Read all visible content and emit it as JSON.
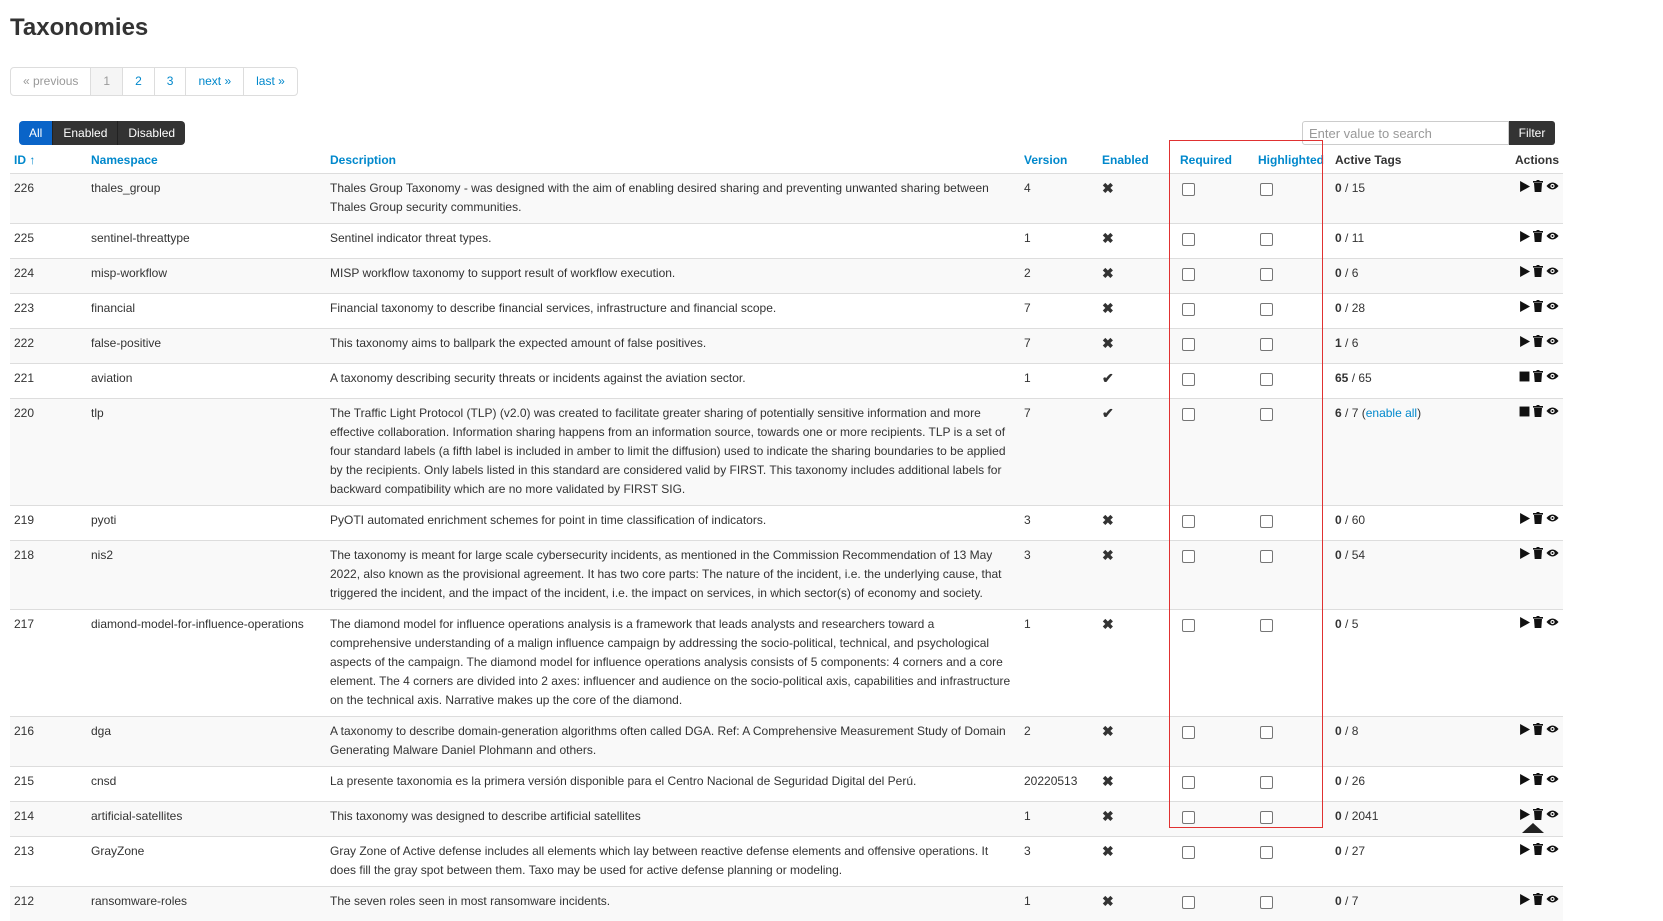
{
  "page": {
    "title": "Taxonomies"
  },
  "pagination": [
    "« previous",
    "1",
    "2",
    "3",
    "next »",
    "last »"
  ],
  "filter_toggle": [
    "All",
    "Enabled",
    "Disabled"
  ],
  "search": {
    "placeholder": "Enter value to search",
    "button": "Filter"
  },
  "columns": {
    "id": "ID ↑",
    "namespace": "Namespace",
    "description": "Description",
    "version": "Version",
    "enabled": "Enabled",
    "required": "Required",
    "highlighted": "Highlighted",
    "active_tags": "Active Tags",
    "actions": "Actions"
  },
  "rows": [
    {
      "id": "226",
      "namespace": "thales_group",
      "description": "Thales Group Taxonomy - was designed with the aim of enabling desired sharing and preventing unwanted sharing between Thales Group security communities.",
      "version": "4",
      "enabled_icon": "✖",
      "active": "0",
      "total": "/ 15",
      "enable_all": "",
      "first_action_icon": "play-icon"
    },
    {
      "id": "225",
      "namespace": "sentinel-threattype",
      "description": "Sentinel indicator threat types.",
      "version": "1",
      "enabled_icon": "✖",
      "active": "0",
      "total": "/ 11",
      "enable_all": "",
      "first_action_icon": "play-icon"
    },
    {
      "id": "224",
      "namespace": "misp-workflow",
      "description": "MISP workflow taxonomy to support result of workflow execution.",
      "version": "2",
      "enabled_icon": "✖",
      "active": "0",
      "total": "/ 6",
      "enable_all": "",
      "first_action_icon": "play-icon"
    },
    {
      "id": "223",
      "namespace": "financial",
      "description": "Financial taxonomy to describe financial services, infrastructure and financial scope.",
      "version": "7",
      "enabled_icon": "✖",
      "active": "0",
      "total": "/ 28",
      "enable_all": "",
      "first_action_icon": "play-icon"
    },
    {
      "id": "222",
      "namespace": "false-positive",
      "description": "This taxonomy aims to ballpark the expected amount of false positives.",
      "version": "7",
      "enabled_icon": "✖",
      "active": "1",
      "total": "/ 6",
      "enable_all": "",
      "first_action_icon": "play-icon"
    },
    {
      "id": "221",
      "namespace": "aviation",
      "description": "A taxonomy describing security threats or incidents against the aviation sector.",
      "version": "1",
      "enabled_icon": "✔",
      "active": "65",
      "total": "/ 65",
      "enable_all": "",
      "first_action_icon": "stop-icon"
    },
    {
      "id": "220",
      "namespace": "tlp",
      "description": "The Traffic Light Protocol (TLP) (v2.0) was created to facilitate greater sharing of potentially sensitive information and more effective collaboration. Information sharing happens from an information source, towards one or more recipients. TLP is a set of four standard labels (a fifth label is included in amber to limit the diffusion) used to indicate the sharing boundaries to be applied by the recipients. Only labels listed in this standard are considered valid by FIRST. This taxonomy includes additional labels for backward compatibility which are no more validated by FIRST SIG.",
      "version": "7",
      "enabled_icon": "✔",
      "active": "6",
      "total": "/ 7",
      "enable_all": "enable all",
      "first_action_icon": "stop-icon"
    },
    {
      "id": "219",
      "namespace": "pyoti",
      "description": "PyOTI automated enrichment schemes for point in time classification of indicators.",
      "version": "3",
      "enabled_icon": "✖",
      "active": "0",
      "total": "/ 60",
      "enable_all": "",
      "first_action_icon": "play-icon"
    },
    {
      "id": "218",
      "namespace": "nis2",
      "description": "The taxonomy is meant for large scale cybersecurity incidents, as mentioned in the Commission Recommendation of 13 May 2022, also known as the provisional agreement. It has two core parts: The nature of the incident, i.e. the underlying cause, that triggered the incident, and the impact of the incident, i.e. the impact on services, in which sector(s) of economy and society.",
      "version": "3",
      "enabled_icon": "✖",
      "active": "0",
      "total": "/ 54",
      "enable_all": "",
      "first_action_icon": "play-icon"
    },
    {
      "id": "217",
      "namespace": "diamond-model-for-influence-operations",
      "description": "The diamond model for influence operations analysis is a framework that leads analysts and researchers toward a comprehensive understanding of a malign influence campaign by addressing the socio-political, technical, and psychological aspects of the campaign. The diamond model for influence operations analysis consists of 5 components: 4 corners and a core element. The 4 corners are divided into 2 axes: influencer and audience on the socio-political axis, capabilities and infrastructure on the technical axis. Narrative makes up the core of the diamond.",
      "version": "1",
      "enabled_icon": "✖",
      "active": "0",
      "total": "/ 5",
      "enable_all": "",
      "first_action_icon": "play-icon"
    },
    {
      "id": "216",
      "namespace": "dga",
      "description": "A taxonomy to describe domain-generation algorithms often called DGA. Ref: A Comprehensive Measurement Study of Domain Generating Malware Daniel Plohmann and others.",
      "version": "2",
      "enabled_icon": "✖",
      "active": "0",
      "total": "/ 8",
      "enable_all": "",
      "first_action_icon": "play-icon"
    },
    {
      "id": "215",
      "namespace": "cnsd",
      "description": "La presente taxonomia es la primera versión disponible para el Centro Nacional de Seguridad Digital del Perú.",
      "version": "20220513",
      "enabled_icon": "✖",
      "active": "0",
      "total": "/ 26",
      "enable_all": "",
      "first_action_icon": "play-icon"
    },
    {
      "id": "214",
      "namespace": "artificial-satellites",
      "description": "This taxonomy was designed to describe artificial satellites",
      "version": "1",
      "enabled_icon": "✖",
      "active": "0",
      "total": "/ 2041",
      "enable_all": "",
      "first_action_icon": "play-icon"
    },
    {
      "id": "213",
      "namespace": "GrayZone",
      "description": "Gray Zone of Active defense includes all elements which lay between reactive defense elements and offensive operations. It does fill the gray spot between them. Taxo may be used for active defense planning or modeling.",
      "version": "3",
      "enabled_icon": "✖",
      "active": "0",
      "total": "/ 27",
      "enable_all": "",
      "first_action_icon": "play-icon"
    },
    {
      "id": "212",
      "namespace": "ransomware-roles",
      "description": "The seven roles seen in most ransomware incidents.",
      "version": "1",
      "enabled_icon": "✖",
      "active": "0",
      "total": "/ 7",
      "enable_all": "",
      "first_action_icon": "play-icon"
    }
  ]
}
